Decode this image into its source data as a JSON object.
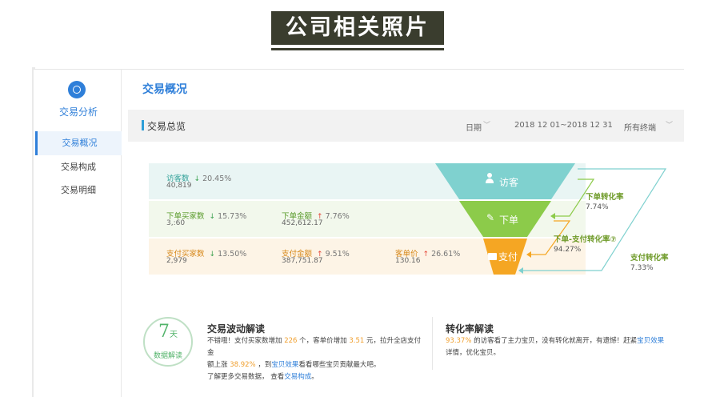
{
  "banner": {
    "title": "公司相关照片"
  },
  "sidebar": {
    "title": "交易分析",
    "items": [
      {
        "label": "交易概况"
      },
      {
        "label": "交易构成"
      },
      {
        "label": "交易明细"
      }
    ]
  },
  "main": {
    "title": "交易概况",
    "overview": {
      "title": "交易总览",
      "date_label": "日期",
      "date_range": "2018 12 01~2018 12 31",
      "terminal": "所有终端"
    }
  },
  "funnel": {
    "stages": [
      {
        "label": "访客"
      },
      {
        "label": "下单"
      },
      {
        "label": "支付"
      }
    ],
    "rows": [
      [
        {
          "label": "访客数",
          "direction": "down",
          "pct": "20.45%",
          "value": "40,819"
        }
      ],
      [
        {
          "label": "下单买家数",
          "direction": "down",
          "pct": "15.73%",
          "value": "3,:60"
        },
        {
          "label": "下单金额",
          "direction": "up",
          "pct": "7.76%",
          "value": "452,612.17"
        }
      ],
      [
        {
          "label": "支付买家数",
          "direction": "down",
          "pct": "13.50%",
          "value": "2,979"
        },
        {
          "label": "支付金额",
          "direction": "up",
          "pct": "9.51%",
          "value": "387,751.87"
        },
        {
          "label": "客单价",
          "direction": "up",
          "pct": "26.61%",
          "value": "130.16"
        }
      ]
    ],
    "conversions": [
      {
        "name": "下单转化率",
        "value": "7.74%"
      },
      {
        "name": "下单-支付转化率⑦",
        "value": "94.27%"
      },
      {
        "name": "支付转化率",
        "value": "7.33%"
      }
    ],
    "colors": {
      "teal": "#7fd1cf",
      "green": "#8ccb4a",
      "orange": "#f5a623"
    }
  },
  "badge": {
    "number": "7",
    "unit": "天",
    "text": "数据解读"
  },
  "fluctuation": {
    "title": "交易波动解读",
    "line1_a": "不错哦！支付买家数增加",
    "line1_hl1": "226",
    "line1_b": "个，客单价增加",
    "line1_hl2": "3.51",
    "line1_c": "元，拉升全店支付金",
    "line2_a": "额上涨",
    "line2_hl": "38.92%",
    "line2_b": "，到",
    "line2_link": "宝贝效果",
    "line2_c": "看看哪些宝贝贡献最大吧。",
    "line3_a": "了解更多交易数据，",
    "line3_b": "查看",
    "line3_link": "交易构成",
    "line3_c": "。"
  },
  "conversion_reading": {
    "title": "转化率解读",
    "line1_hl": "93.37%",
    "line1_a": "的访客看了主力宝贝，没有转化就离开，有遗憾！赶紧",
    "line1_link": "宝贝效果",
    "line2": "详情，优化宝贝。"
  }
}
